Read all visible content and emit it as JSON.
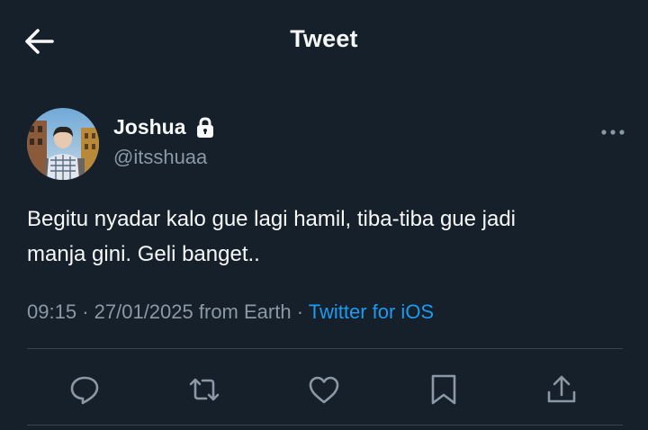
{
  "header": {
    "title": "Tweet",
    "back_icon": "arrow-left-icon"
  },
  "author": {
    "name": "Joshua",
    "handle": "@itsshuaa",
    "protected_icon": "lock-icon",
    "avatar_icon": "profile-photo"
  },
  "tweet": {
    "text_line1": "Begitu nyadar kalo gue lagi hamil, tiba-tiba gue jadi",
    "text_line2": "manja gini. Geli banget..",
    "time": "09:15",
    "separator": "·",
    "date": "27/01/2025",
    "location": "from Earth",
    "source": "Twitter for iOS"
  },
  "actions": [
    {
      "icon": "reply-icon"
    },
    {
      "icon": "retweet-icon"
    },
    {
      "icon": "like-icon"
    },
    {
      "icon": "bookmark-icon"
    },
    {
      "icon": "share-icon"
    }
  ],
  "colors": {
    "background": "#15202b",
    "text_primary": "#f7f9f9",
    "text_secondary": "#8b98a5",
    "accent": "#1d9bf0",
    "divider": "#38444d"
  }
}
